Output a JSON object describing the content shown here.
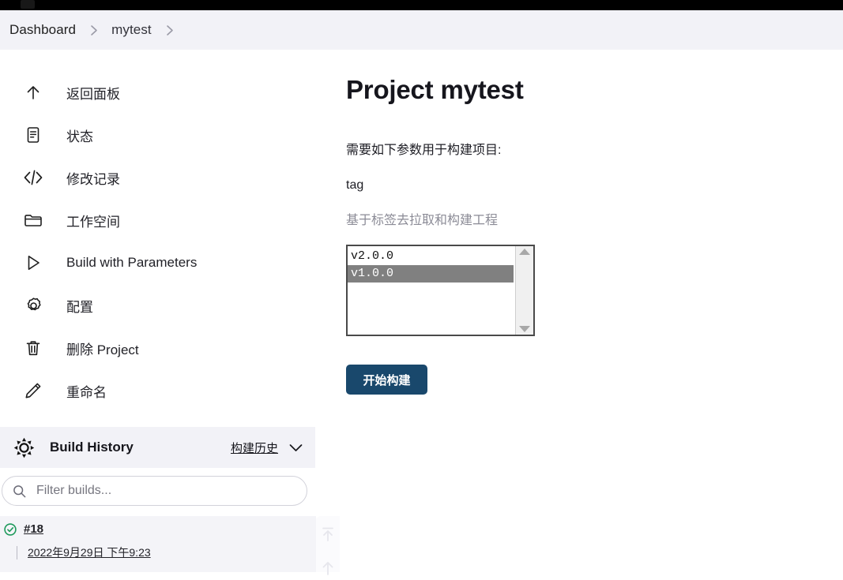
{
  "topbar": {
    "logo_icon": "jenkins-logo-icon"
  },
  "breadcrumb": {
    "items": [
      {
        "label": "Dashboard"
      },
      {
        "label": "mytest"
      }
    ],
    "separator_icon": "chevron-right-icon"
  },
  "sidebar": {
    "items": [
      {
        "icon": "arrow-up-icon",
        "label": "返回面板"
      },
      {
        "icon": "document-icon",
        "label": "状态"
      },
      {
        "icon": "code-icon",
        "label": "修改记录"
      },
      {
        "icon": "folder-icon",
        "label": "工作空间"
      },
      {
        "icon": "play-icon",
        "label": "Build with Parameters"
      },
      {
        "icon": "gear-icon",
        "label": "配置"
      },
      {
        "icon": "trash-icon",
        "label": "删除 Project"
      },
      {
        "icon": "pencil-icon",
        "label": "重命名"
      }
    ],
    "build_history": {
      "icon": "build-history-icon",
      "title": "Build History",
      "link_label": "构建历史",
      "chevron_icon": "chevron-down-icon"
    },
    "filter": {
      "icon": "search-icon",
      "placeholder": "Filter builds...",
      "value": ""
    },
    "builds": [
      {
        "status_icon": "success-check-icon",
        "status_color": "#1f9a5c",
        "number": "#18",
        "date": "2022年9月29日 下午9:23"
      }
    ],
    "scroll_arrows": {
      "top_icon": "arrow-up-to-line-icon",
      "bottom_icon": "arrow-up-icon"
    }
  },
  "main": {
    "title": "Project mytest",
    "intro": "需要如下参数用于构建项目:",
    "parameter": {
      "name": "tag",
      "description": "基于标签去拉取和构建工程",
      "options": [
        {
          "value": "v2.0.0",
          "selected": false
        },
        {
          "value": "v1.0.0",
          "selected": true
        }
      ],
      "scroll_up_icon": "triangle-up-icon",
      "scroll_down_icon": "triangle-down-icon"
    },
    "submit_label": "开始构建"
  },
  "colors": {
    "accent_button": "#19486c",
    "panel_bg": "#f2f2f7",
    "selected_option_bg": "#808080",
    "success": "#1f9a5c",
    "muted_text": "#8b8b96"
  }
}
